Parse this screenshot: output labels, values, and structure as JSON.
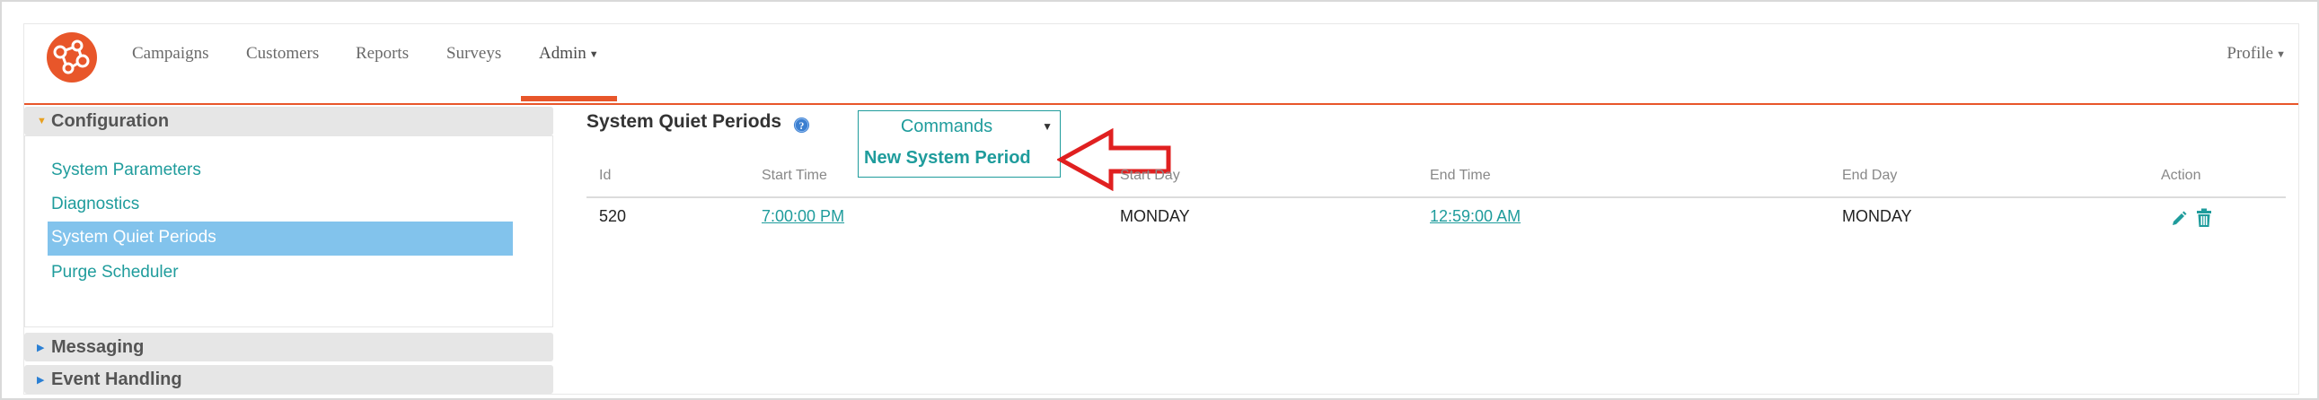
{
  "nav": {
    "items": [
      "Campaigns",
      "Customers",
      "Reports",
      "Surveys"
    ],
    "admin": "Admin",
    "profile": "Profile"
  },
  "sidebar": {
    "configuration": "Configuration",
    "config_items": [
      "System Parameters",
      "Diagnostics",
      "System Quiet Periods",
      "Purge Scheduler"
    ],
    "active_item": "System Quiet Periods",
    "messaging": "Messaging",
    "event_handling": "Event Handling"
  },
  "main": {
    "title": "System Quiet Periods",
    "commands_label": "Commands",
    "commands_menu_item": "New System Period"
  },
  "table": {
    "headers": [
      "Id",
      "Start Time",
      "Start Day",
      "End Time",
      "End Day",
      "Action"
    ],
    "rows": [
      {
        "id": "520",
        "start_time": "7:00:00 PM",
        "start_day": "MONDAY",
        "end_time": "12:59:00 AM",
        "end_day": "MONDAY"
      }
    ]
  },
  "colors": {
    "brand": "#e8562a",
    "accent": "#1f9c9c",
    "active_bg": "#82c3ec",
    "annotation": "#e02020"
  },
  "icons": [
    "brand-logo-icon",
    "info-icon",
    "dropdown-caret-icon",
    "pencil-icon",
    "trash-icon",
    "annotation-arrow"
  ]
}
